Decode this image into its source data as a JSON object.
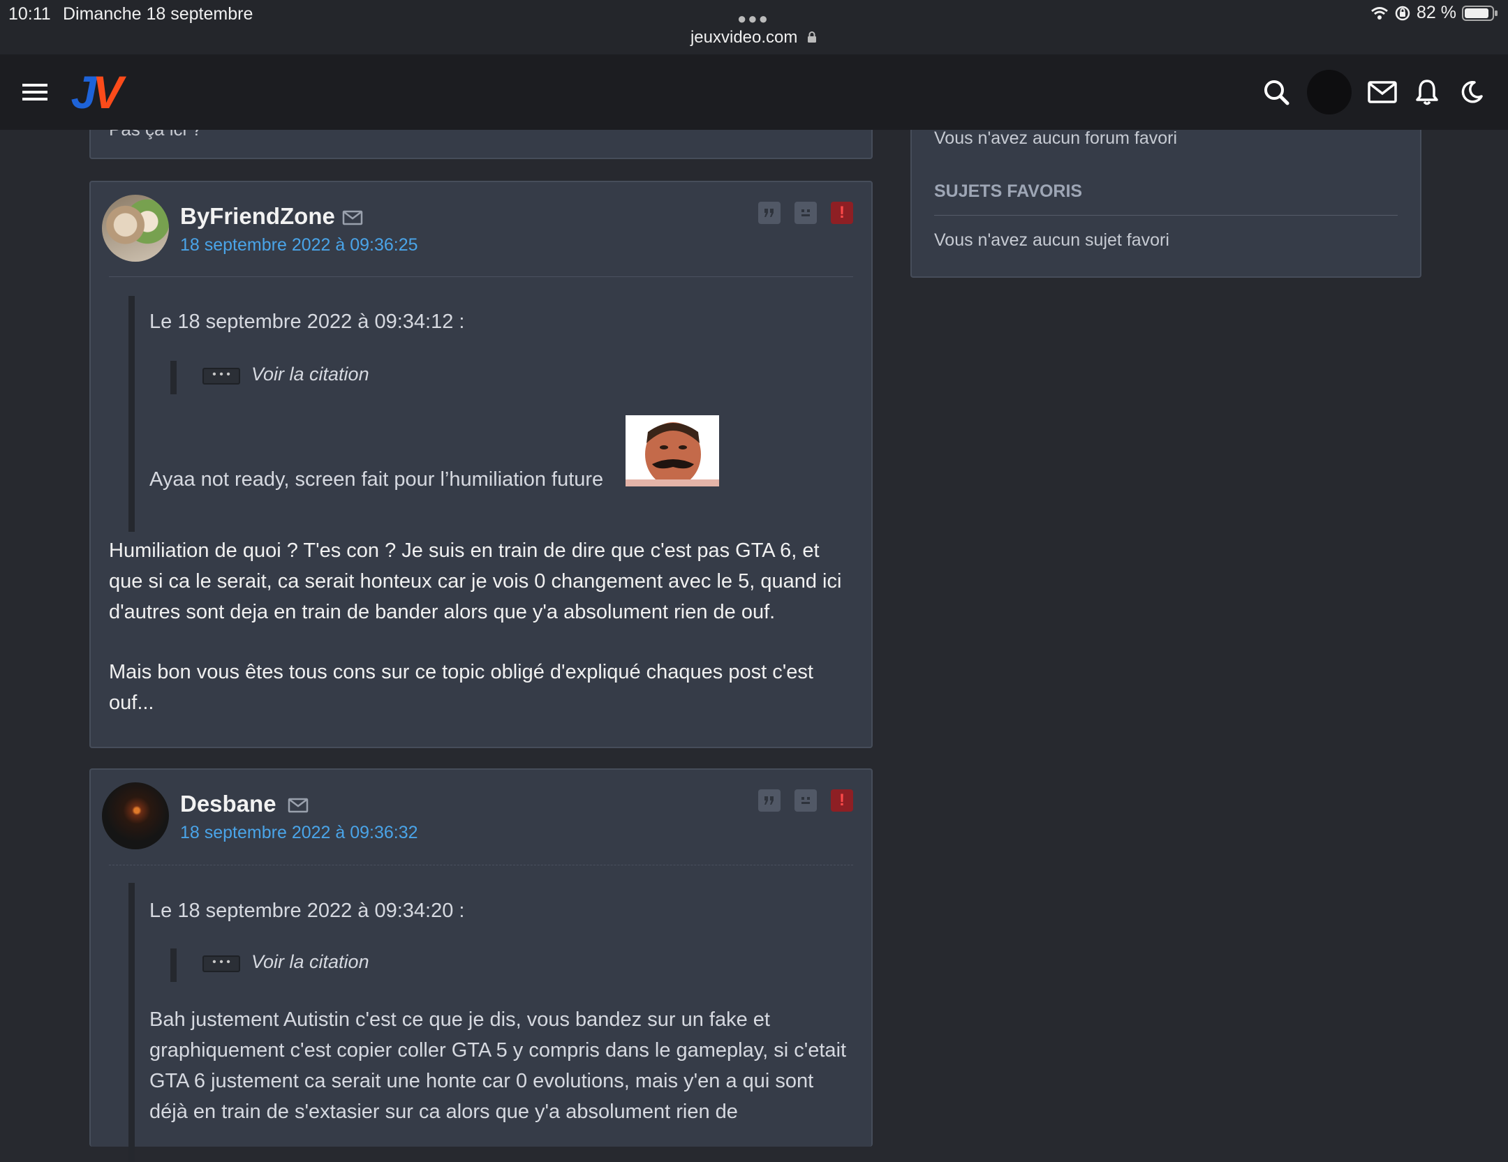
{
  "status_bar": {
    "time": "10:11",
    "date": "Dimanche 18 septembre",
    "url": "jeuxvideo.com",
    "battery": "82 %"
  },
  "navbar": {
    "logo_j": "J",
    "logo_v": "V"
  },
  "prev_card": {
    "snippet": "Pas ça ici ?"
  },
  "posts": [
    {
      "author": "ByFriendZone",
      "date": "18 septembre 2022 à 09:36:25",
      "quote_header": "Le 18 septembre 2022 à 09:34:12 :",
      "voir_citation": "Voir la citation",
      "vc_dots": "• • •",
      "quote_body": "Ayaa not ready, screen fait pour l’humiliation future",
      "paragraphs": [
        "Humiliation de quoi ? T'es con ? Je suis en train de dire que c'est pas GTA 6, et que si ca le serait, ca serait honteux car je vois 0 changement avec le 5, quand ici d'autres sont deja en train de bander alors que y'a absolument rien de ouf.",
        "Mais bon vous êtes tous cons sur ce topic obligé d'expliqué chaques post c'est ouf..."
      ]
    },
    {
      "author": "Desbane",
      "date": "18 septembre 2022 à 09:36:32",
      "quote_header": "Le 18 septembre 2022 à 09:34:20 :",
      "voir_citation": "Voir la citation",
      "vc_dots": "• • •",
      "quote_body": "Bah justement Autistin c'est ce que je dis, vous bandez sur un fake et graphiquement c'est copier coller GTA 5 y compris dans le gameplay, si c'etait GTA 6 justement ca serait une honte car 0 evolutions, mais y'en a qui sont déjà en train de s'extasier sur ca alors que y'a absolument rien de"
    }
  ],
  "sidebar": {
    "no_forum": "Vous n'avez aucun forum favori",
    "sujets_title": "SUJETS FAVORIS",
    "no_sujet": "Vous n'avez aucun sujet favori"
  },
  "colors": {
    "accent_blue": "#4aa4e8",
    "alert_red": "#8e1f24",
    "card_bg": "#363c48",
    "page_bg": "#27292f"
  },
  "icons": [
    "menu-icon",
    "search-icon",
    "mail-icon",
    "bell-icon",
    "moon-icon",
    "quote-icon",
    "mp-icon",
    "alert-icon"
  ]
}
